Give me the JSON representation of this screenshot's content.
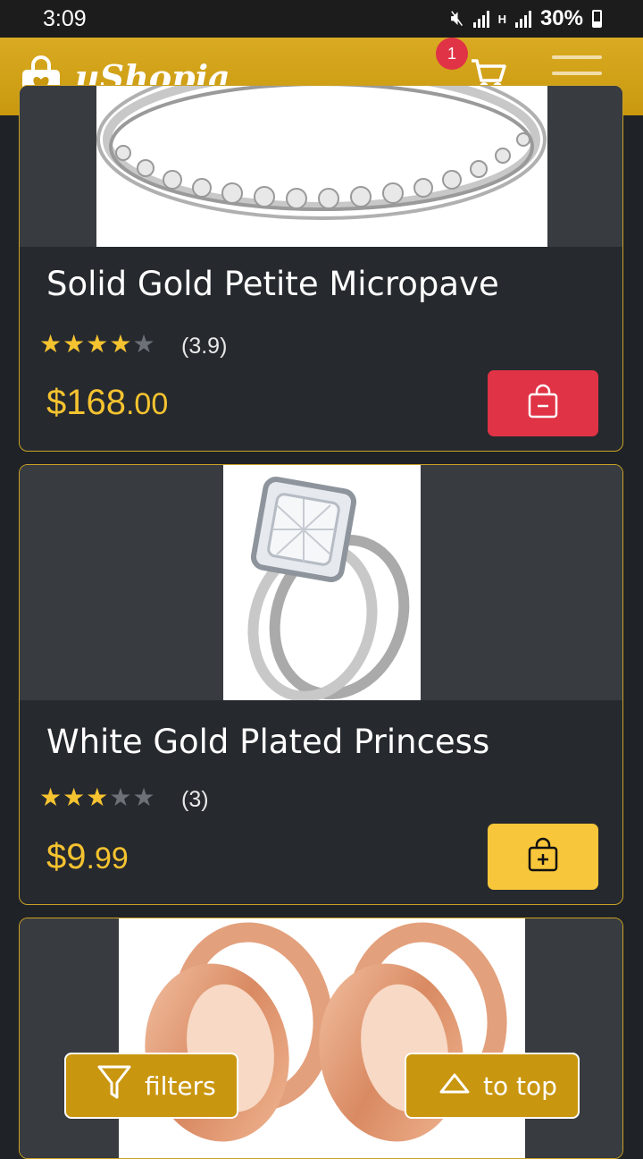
{
  "status_bar": {
    "time": "3:09",
    "battery": "30%",
    "network": "H"
  },
  "header": {
    "brand": "uShopia",
    "cart_count": "1",
    "icons": {
      "logo": "shopping-bag-heart-icon",
      "cart": "cart-icon",
      "menu": "hamburger-menu-icon"
    }
  },
  "products": [
    {
      "title": "Solid Gold Petite Micropave",
      "rating": 3.9,
      "rating_text": "(3.9)",
      "filled_stars": 4,
      "price_dollars": "$168",
      "price_cents": ".00",
      "cart_action": "remove-from-cart",
      "button_color": "#e03346"
    },
    {
      "title": "White Gold Plated Princess",
      "rating": 3,
      "rating_text": "(3)",
      "filled_stars": 3,
      "price_dollars": "$9",
      "price_cents": ".99",
      "cart_action": "add-to-cart",
      "button_color": "#f8c63a"
    }
  ],
  "buttons": {
    "filters": "filters",
    "to_top": "to top"
  },
  "colors": {
    "accent": "#c9980e",
    "star": "#f5c330",
    "price": "#f5c330",
    "card_border": "#c9a227"
  }
}
